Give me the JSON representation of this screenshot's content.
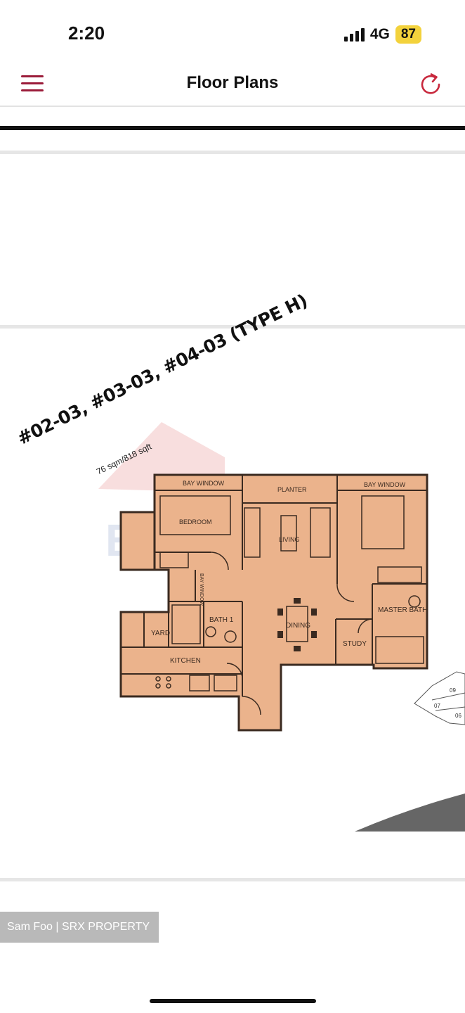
{
  "status_bar": {
    "time": "2:20",
    "network": "4G",
    "battery": "87",
    "battery_color": "#f3d23c"
  },
  "nav": {
    "title": "Floor Plans",
    "menu_icon": "hamburger-menu-icon",
    "refresh_icon": "refresh-icon",
    "accent_color": "#9b1c3a"
  },
  "floor_plan": {
    "unit_label": "#02-03, #03-03, #04-03 (TYPE H)",
    "area_label": "76 sqm/818 sqft",
    "fill_color": "#ebb38c",
    "rooms": {
      "bay_window_left": "BAY WINDOW",
      "planter": "PLANTER",
      "bay_window_right": "BAY WINDOW",
      "bedroom": "BEDROOM",
      "living": "LIVING",
      "bay_window_small": "BAY WINDOW",
      "yard": "YARD",
      "bath_1": "BATH 1",
      "dining": "DINING",
      "master_bath": "MASTER BATH",
      "study": "STUDY",
      "kitchen": "KITCHEN"
    },
    "keyplan_labels": [
      "09",
      "07",
      "06"
    ]
  },
  "credit": "Sam Foo | SRX PROPERTY"
}
